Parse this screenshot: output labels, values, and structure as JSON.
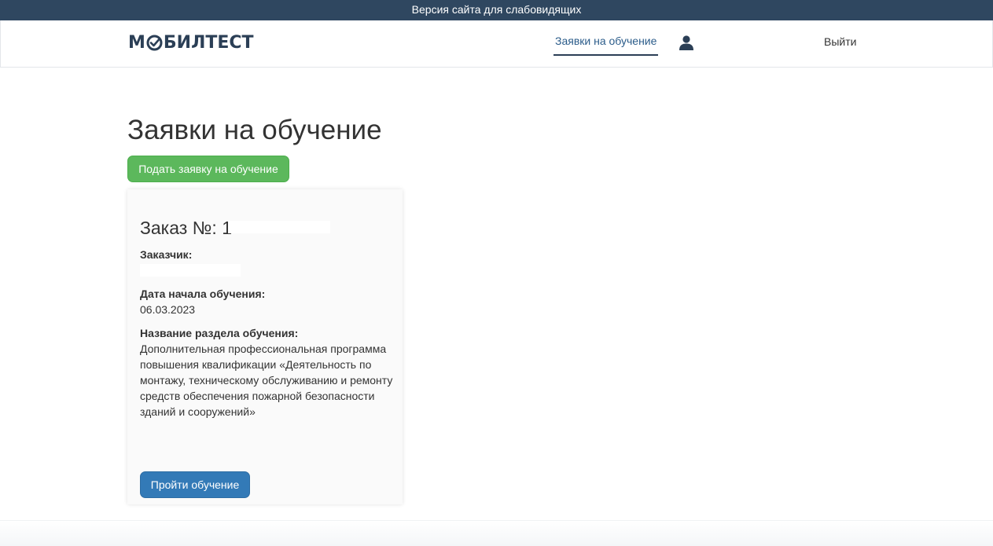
{
  "accessibility_bar": {
    "label": "Версия сайта для слабовидящих"
  },
  "header": {
    "logo": {
      "prefix": "М",
      "suffix": "БИЛТЕСТ",
      "icon": "check-circle-logo-icon"
    },
    "nav": {
      "applications_label": "Заявки на обучение"
    },
    "profile_icon": "user-icon",
    "logout_label": "Выйти"
  },
  "main": {
    "title": "Заявки на обучение",
    "apply_button_label": "Подать заявку на обучение",
    "order_card": {
      "order_label": "Заказ №: ",
      "order_number_visible": "1",
      "customer_label": "Заказчик:",
      "start_date_label": "Дата начала обучения:",
      "start_date": "06.03.2023",
      "section_label": "Название раздела обучения:",
      "section_name": "Дополнительная профессиональная программа повышения квалификации «Деятельность по монтажу, техническому обслуживанию и ремонту средств обеспечения пожарной безопасности зданий и сооружений»",
      "start_button_label": "Пройти обучение"
    }
  },
  "colors": {
    "topbar": "#2f4760",
    "logo": "#2b3f56",
    "nav_link": "#2b5c8a",
    "apply_button": "#5cb85c",
    "start_button": "#337ab7"
  }
}
